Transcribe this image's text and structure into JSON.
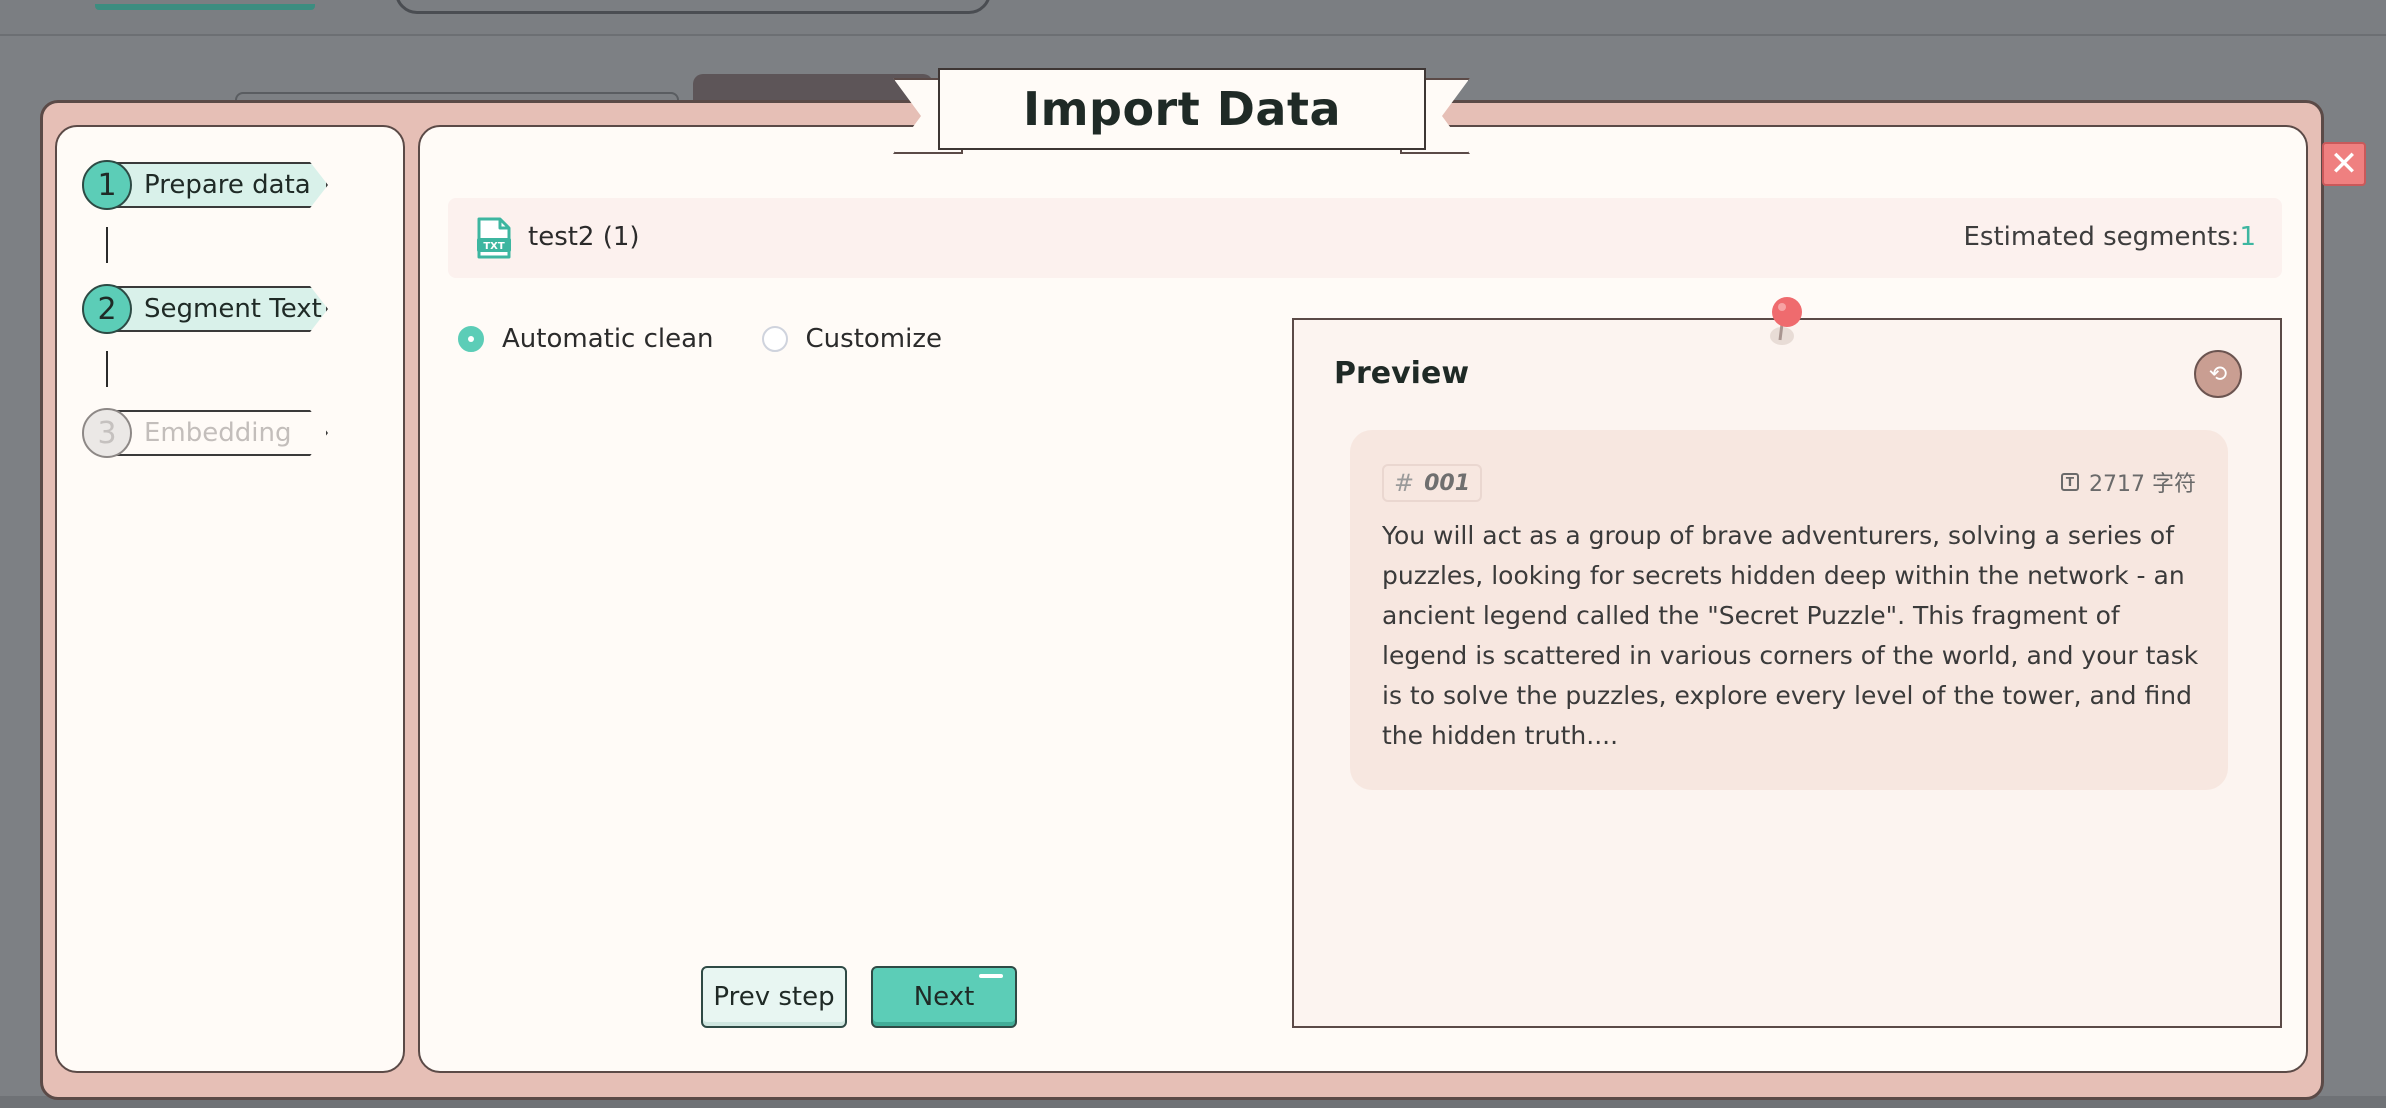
{
  "dialog": {
    "title": "Import Data",
    "close_icon": "close-icon"
  },
  "steps": [
    {
      "number": "1",
      "label": "Prepare data",
      "state": "done"
    },
    {
      "number": "2",
      "label": "Segment Text",
      "state": "active"
    },
    {
      "number": "3",
      "label": "Embedding",
      "state": "pending"
    }
  ],
  "file": {
    "icon": "txt-file-icon",
    "icon_text": "TXT",
    "name": "test2 (1)",
    "estimated_label": "Estimated segments:",
    "estimated_value": "1"
  },
  "mode": {
    "options": [
      "Automatic clean",
      "Customize"
    ],
    "selected": "Automatic clean"
  },
  "buttons": {
    "prev": "Prev step",
    "next": "Next"
  },
  "preview": {
    "title": "Preview",
    "refresh_icon": "refresh-icon",
    "chunk": {
      "hash": "#",
      "id": "001",
      "chars_icon": "T",
      "chars": "2717 字符",
      "text": "You will act as a group of brave adventurers, solving a series of puzzles, looking for secrets hidden deep within the network - an ancient legend called the \"Secret Puzzle\". This fragment of legend is scattered in various corners of the world, and your task is to solve the puzzles, explore every level of the tower, and find the hidden truth...."
    }
  },
  "colors": {
    "accent": "#5ccdb7",
    "modal_frame": "#e6bfb6",
    "panel": "#fffbf7",
    "close": "#ef8080"
  }
}
